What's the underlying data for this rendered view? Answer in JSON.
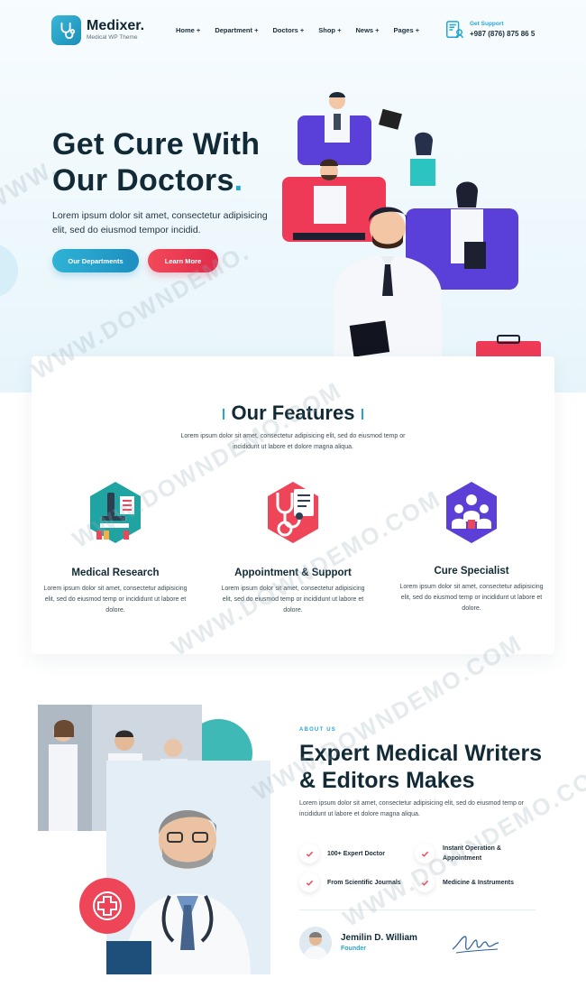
{
  "header": {
    "logo_title": "Medixer.",
    "logo_subtitle": "Medical WP Theme",
    "nav": [
      "Home +",
      "Department +",
      "Doctors +",
      "Shop +",
      "News +",
      "Pages +"
    ],
    "support_label": "Get Support",
    "support_phone": "+987 (876) 875 86 5"
  },
  "hero": {
    "title_line1": "Get Cure With",
    "title_line2": "Our Doctors",
    "title_dot": ".",
    "description": "Lorem ipsum dolor sit amet, consectetur adipisicing elit, sed do eiusmod tempor incidid.",
    "primary_button": "Our Departments",
    "secondary_button": "Learn More"
  },
  "features": {
    "title": "Our Features",
    "description": "Lorem ipsum dolor sit amet, consectetur adipisicing elit, sed do eiusmod temp or incididunt ut labore et dolore magna aliqua.",
    "items": [
      {
        "title": "Medical Research",
        "text": "Lorem ipsum dolor sit amet, consectetur adipisicing elit, sed do eiusmod temp or incididunt ut labore et dolore.",
        "icon": "microscope-icon",
        "color": "#1fa4a2"
      },
      {
        "title": "Appointment & Support",
        "text": "Lorem ipsum dolor sit amet, consectetur adipisicing elit, sed do eiusmod temp or incididunt ut labore et dolore.",
        "icon": "stethoscope-icon",
        "color": "#ee4658"
      },
      {
        "title": "Cure Specialist",
        "text": "Lorem ipsum dolor sit amet, consectetur adipisicing elit, sed do eiusmod temp or incididunt ut labore et dolore.",
        "icon": "specialists-icon",
        "color": "#5b3fd6"
      }
    ]
  },
  "about": {
    "tag": "ABOUT US",
    "title_line1": "Expert Medical Writers",
    "title_line2": "& Editors Makes",
    "description": "Lorem ipsum dolor sit amet, consectetur adipisicing elit, sed do eiusmod temp or incididunt ut labore et dolore magna aliqua.",
    "checks": [
      "100+ Expert Doctor",
      "Instant Operation & Appointment",
      "From Scientific Journals",
      "Medicine & Instruments"
    ],
    "author_name": "Jemilin D. William",
    "author_role": "Founder"
  },
  "colors": {
    "accent": "#23a6d0",
    "red": "#ee4658",
    "dark": "#112a36"
  }
}
